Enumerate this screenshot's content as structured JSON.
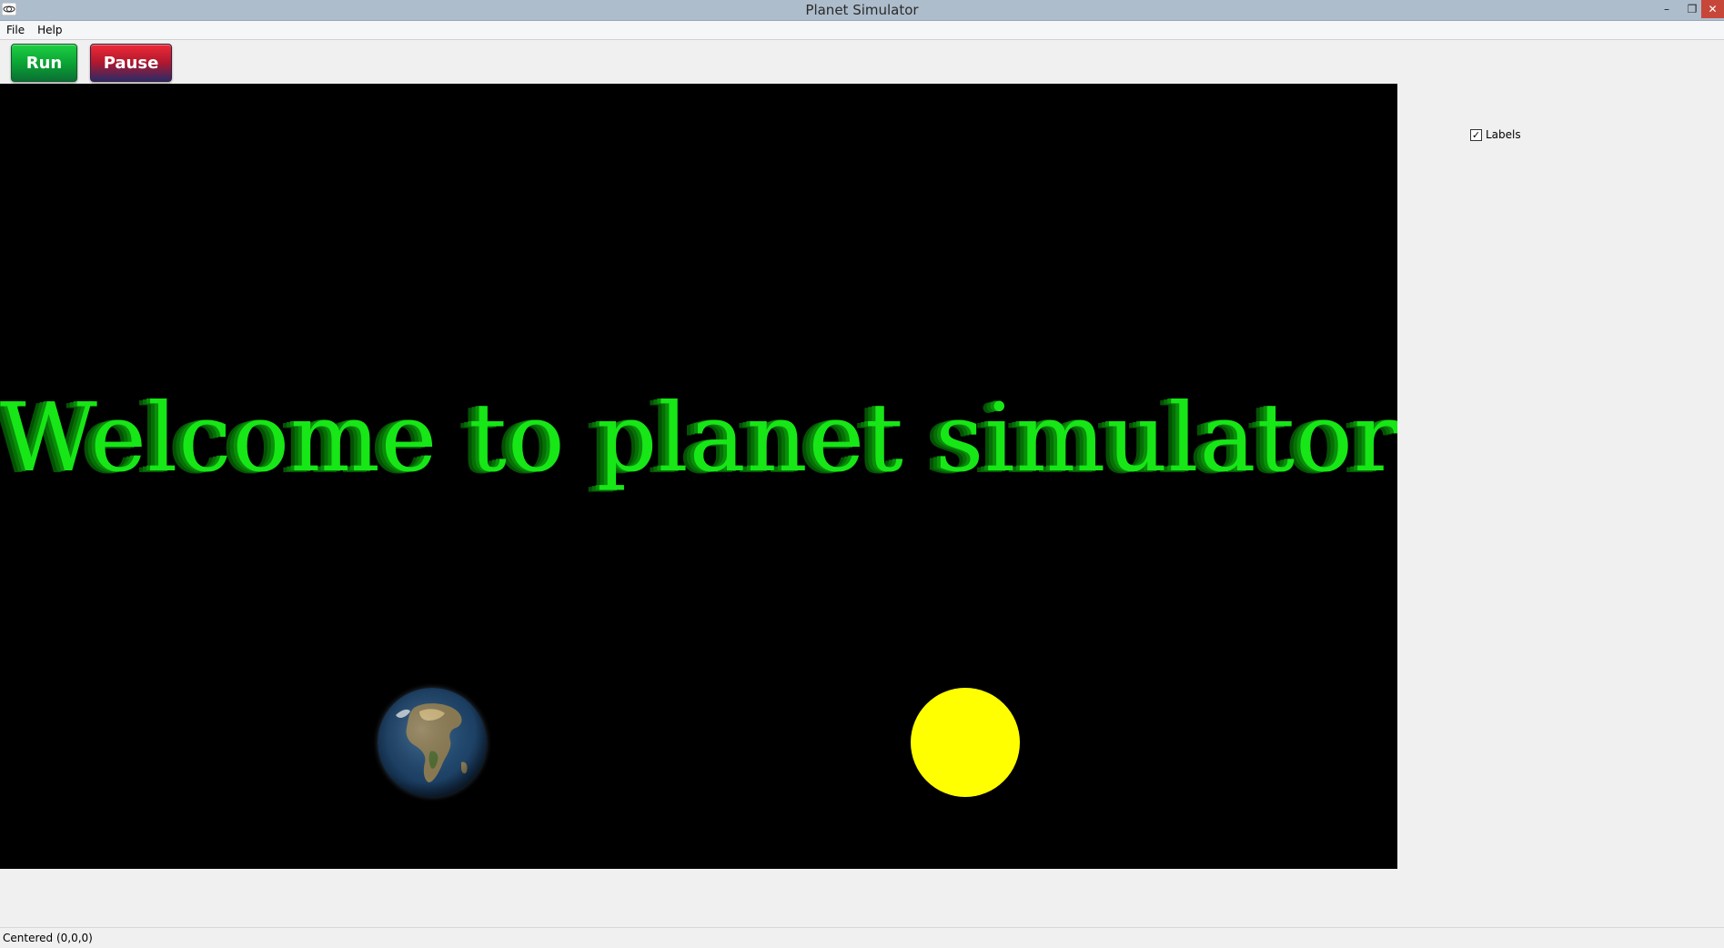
{
  "window": {
    "title": "Planet Simulator",
    "controls": {
      "minimize": "–",
      "maximize": "❐",
      "close": "✕"
    }
  },
  "menu": {
    "items": [
      {
        "label": "File"
      },
      {
        "label": "Help"
      }
    ]
  },
  "toolbar": {
    "run_label": "Run",
    "pause_label": "Pause"
  },
  "scene": {
    "headline": "Welcome to planet simulator!",
    "bodies": [
      {
        "name": "earth",
        "icon": "earth-globe"
      },
      {
        "name": "sun",
        "icon": "sun-sphere"
      }
    ],
    "colors": {
      "background": "#000000",
      "headline": "#17e617",
      "sun": "#ffff00"
    }
  },
  "panel": {
    "labels_checkbox": {
      "label": "Labels",
      "checked": true
    }
  },
  "status": {
    "text": "Centered (0,0,0)"
  }
}
